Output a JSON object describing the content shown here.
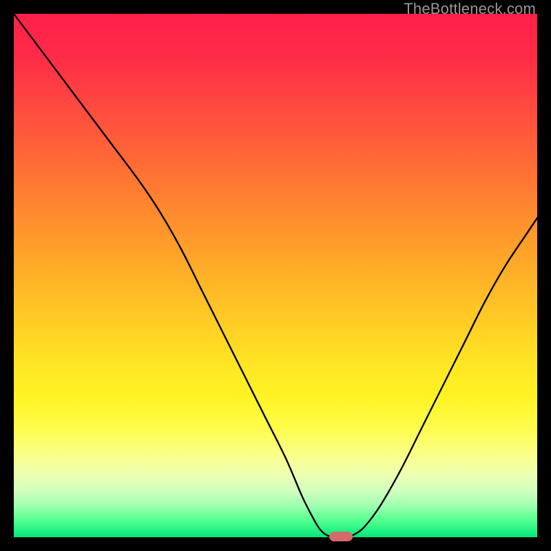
{
  "watermark": "TheBottleneck.com",
  "chart_data": {
    "type": "line",
    "title": "",
    "xlabel": "",
    "ylabel": "",
    "xlim": [
      0,
      100
    ],
    "ylim": [
      0,
      100
    ],
    "x": [
      0,
      6,
      12,
      18,
      24,
      28,
      32,
      36,
      40,
      44,
      48,
      52,
      55,
      57,
      58.5,
      60,
      62,
      63.5,
      65,
      67,
      70,
      74,
      78,
      82,
      86,
      90,
      94,
      98,
      100
    ],
    "values": [
      100,
      92,
      84,
      76,
      68,
      62,
      55,
      47,
      39,
      31,
      23,
      15,
      8,
      4,
      1.5,
      0.3,
      0,
      0,
      0.5,
      2,
      6,
      13,
      21,
      29,
      37,
      45,
      52,
      58,
      61
    ],
    "marker": {
      "x": 62.5,
      "y": 0
    },
    "gradient_stops": [
      {
        "pos": 0,
        "color": "#ff1f4a"
      },
      {
        "pos": 50,
        "color": "#ffca24"
      },
      {
        "pos": 80,
        "color": "#fffc4a"
      },
      {
        "pos": 100,
        "color": "#00e67a"
      }
    ]
  }
}
